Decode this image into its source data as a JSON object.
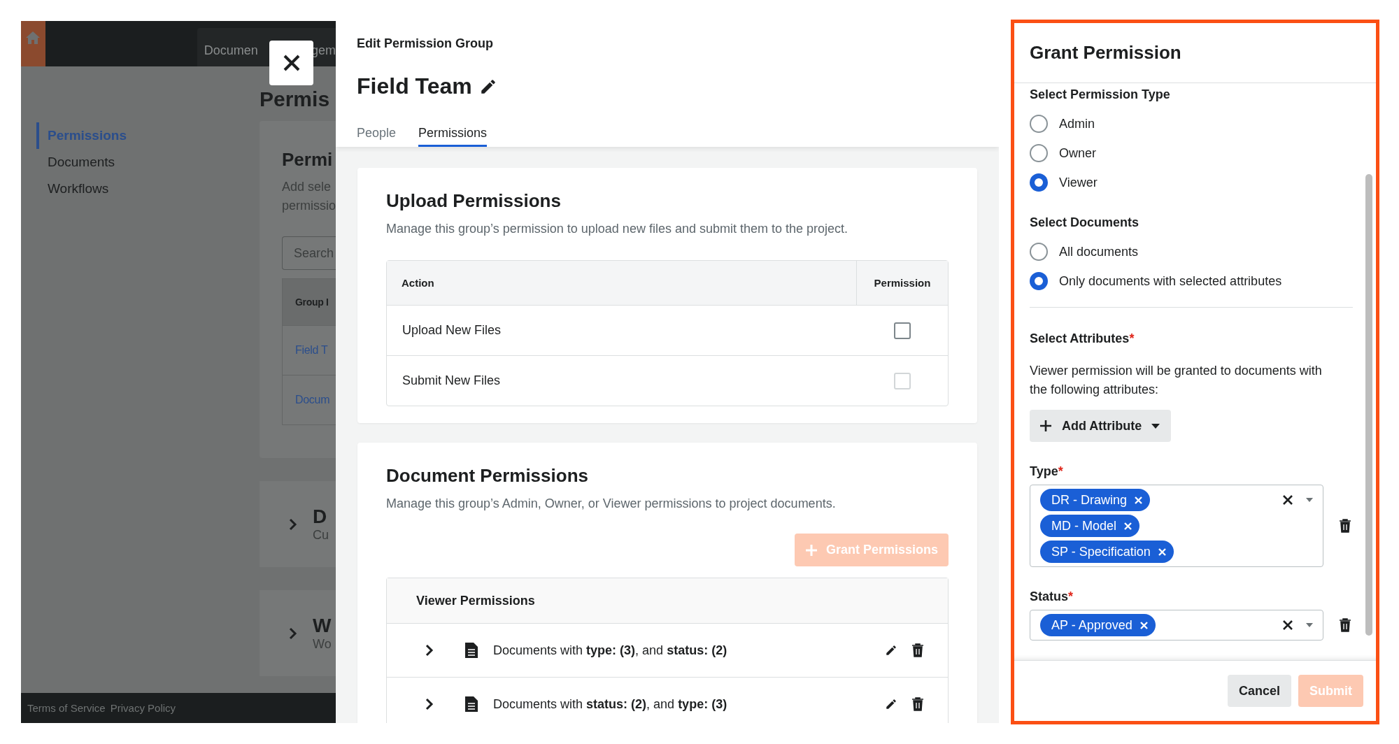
{
  "background": {
    "top_tab": [
      "Documen",
      "gem"
    ],
    "page_title": "Permis",
    "nav": [
      {
        "label": "Permissions",
        "selected": true
      },
      {
        "label": "Documents",
        "selected": false
      },
      {
        "label": "Workflows",
        "selected": false
      }
    ],
    "card": {
      "title": "Permi",
      "description_lines": [
        "Add sele",
        "permissio"
      ],
      "search_placeholder": "Search",
      "column": "Group I",
      "rows": [
        "Field T",
        "Docum"
      ]
    },
    "sections": [
      {
        "title": "D",
        "subtitle": "Cu"
      },
      {
        "title": "W",
        "subtitle": "Wo"
      }
    ],
    "footer_links": [
      "Terms of Service",
      "Privacy Policy"
    ]
  },
  "editor": {
    "eyebrow": "Edit Permission Group",
    "title": "Field Team",
    "tabs": [
      {
        "label": "People",
        "selected": false
      },
      {
        "label": "Permissions",
        "selected": true
      }
    ],
    "upload": {
      "title": "Upload Permissions",
      "description": "Manage this group’s permission to upload new files and submit them to the project.",
      "columns": [
        "Action",
        "Permission"
      ],
      "rows": [
        {
          "action": "Upload New Files",
          "checked": false,
          "disabled": false
        },
        {
          "action": "Submit New Files",
          "checked": false,
          "disabled": true
        }
      ]
    },
    "documents": {
      "title": "Document Permissions",
      "description": "Manage this group’s Admin, Owner, or Viewer permissions to project documents.",
      "grant_button": {
        "label": "Grant Permissions",
        "disabled": true
      },
      "group_title": "Viewer Permissions",
      "rules": [
        {
          "text": "Documents with **type: (3)**, and **status: (2)**"
        },
        {
          "text": "Documents with **status: (2)**, and **type: (3)**"
        }
      ]
    }
  },
  "grant_panel": {
    "title": "Grant Permission",
    "permission_type": {
      "label": "Select Permission Type",
      "options": [
        {
          "label": "Admin",
          "selected": false
        },
        {
          "label": "Owner",
          "selected": false
        },
        {
          "label": "Viewer",
          "selected": true
        }
      ]
    },
    "documents": {
      "label": "Select Documents",
      "options": [
        {
          "label": "All documents",
          "selected": false
        },
        {
          "label": "Only documents with selected attributes",
          "selected": true
        }
      ]
    },
    "attributes": {
      "label": "Select Attributes",
      "required_mark": "*",
      "help": "Viewer permission will be granted to documents with the following attributes:",
      "add_button": "Add Attribute"
    },
    "fields": [
      {
        "label": "Type",
        "required_mark": "*",
        "tags": [
          "DR - Drawing",
          "MD - Model",
          "SP - Specification"
        ]
      },
      {
        "label": "Status",
        "required_mark": "*",
        "tags": [
          "AP - Approved"
        ]
      }
    ],
    "cancel": "Cancel",
    "submit": {
      "label": "Submit",
      "disabled": true
    }
  }
}
